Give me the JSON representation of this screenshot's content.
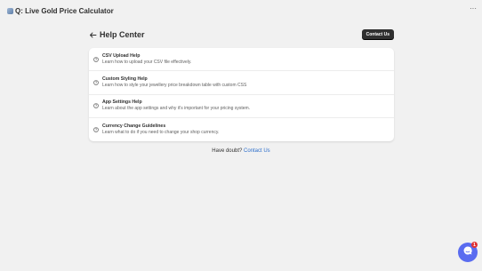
{
  "app": {
    "title": "Q: Live Gold Price Calculator",
    "menu_icon": "more-horizontal-icon"
  },
  "header": {
    "title": "Help Center",
    "contact_button": "Contact Us"
  },
  "help_items": [
    {
      "title": "CSV Upload Help",
      "description": "Learn how to upload your CSV file effectively.",
      "icon": "question-circle-icon"
    },
    {
      "title": "Custom Styling Help",
      "description": "Learn how to style your jewellery price breakdown table with custom CSS",
      "icon": "question-circle-icon"
    },
    {
      "title": "App Settings Help",
      "description": "Learn about the app settings and why it's important for your pricing system.",
      "icon": "question-circle-icon"
    },
    {
      "title": "Currency Change Guidelines",
      "description": "Learn what to do if you need to change your shop currency.",
      "icon": "question-circle-icon"
    }
  ],
  "footer": {
    "prefix": "Have doubt?",
    "link": "Contact Us"
  },
  "chat": {
    "badge_count": "1",
    "icon": "chat-icon"
  },
  "colors": {
    "background": "#f1f1f1",
    "primary_button": "#303030",
    "link": "#2c6ecb",
    "chat_accent": "#5a6cf0",
    "badge": "#e03232"
  }
}
